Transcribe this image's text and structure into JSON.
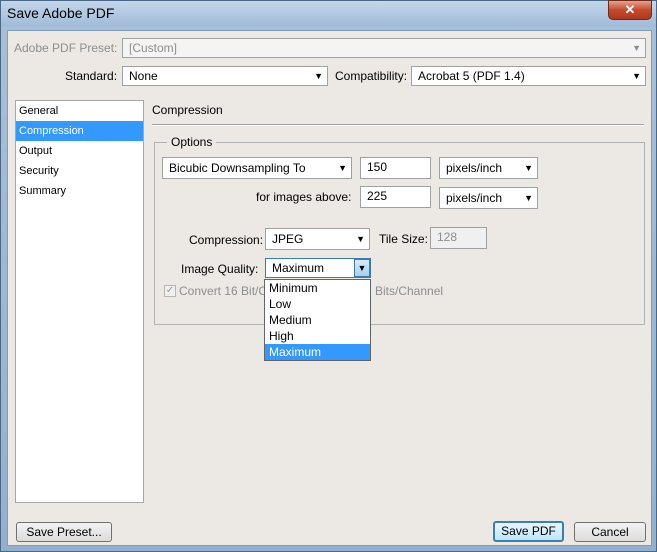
{
  "window": {
    "title": "Save Adobe PDF",
    "close_symbol": "✕"
  },
  "preset": {
    "label": "Adobe PDF Preset:",
    "value": "[Custom]"
  },
  "standard": {
    "label": "Standard:",
    "value": "None"
  },
  "compatibility": {
    "label": "Compatibility:",
    "value": "Acrobat 5 (PDF 1.4)"
  },
  "sidebar": {
    "items": [
      {
        "label": "General",
        "selected": false
      },
      {
        "label": "Compression",
        "selected": true
      },
      {
        "label": "Output",
        "selected": false
      },
      {
        "label": "Security",
        "selected": false
      },
      {
        "label": "Summary",
        "selected": false
      }
    ]
  },
  "section": {
    "title": "Compression"
  },
  "options": {
    "title": "Options",
    "downsampling": "Bicubic Downsampling To",
    "resolution": "150",
    "resolution_unit": "pixels/inch",
    "images_above_label": "for images above:",
    "images_above": "225",
    "images_above_unit": "pixels/inch",
    "compression_label": "Compression:",
    "compression": "JPEG",
    "tile_size_label": "Tile Size:",
    "tile_size": "128",
    "image_quality_label": "Image Quality:",
    "image_quality": "Maximum",
    "convert_label_start": "Convert 16 Bit/C",
    "convert_label_end": "Bits/Channel"
  },
  "quality_options": [
    "Minimum",
    "Low",
    "Medium",
    "High",
    "Maximum"
  ],
  "buttons": {
    "save_preset": "Save Preset...",
    "save_pdf": "Save PDF",
    "cancel": "Cancel"
  }
}
